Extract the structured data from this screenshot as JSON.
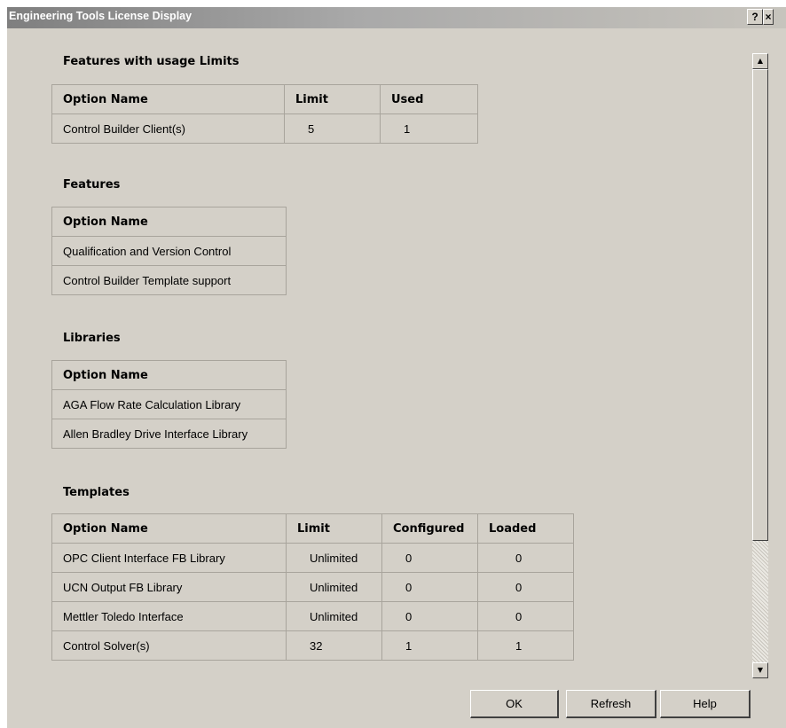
{
  "window": {
    "title": "Engineering Tools License Display",
    "help_glyph": "?",
    "close_glyph": "×"
  },
  "usage_limits": {
    "title": "Features with usage Limits",
    "headers": [
      "Option Name",
      "Limit",
      "Used"
    ],
    "rows": [
      [
        "Control Builder Client(s)",
        "5",
        "1"
      ]
    ]
  },
  "features": {
    "title": "Features",
    "headers": [
      "Option Name"
    ],
    "rows": [
      [
        "Qualification and Version Control"
      ],
      [
        "Control Builder Template support"
      ]
    ]
  },
  "libraries": {
    "title": "Libraries",
    "headers": [
      "Option Name"
    ],
    "rows": [
      [
        "AGA Flow Rate Calculation Library"
      ],
      [
        "Allen Bradley Drive Interface Library"
      ]
    ]
  },
  "templates": {
    "title": "Templates",
    "headers": [
      "Option Name",
      "Limit",
      "Configured",
      "Loaded"
    ],
    "rows": [
      [
        "OPC Client Interface FB Library",
        "Unlimited",
        "0",
        "0"
      ],
      [
        "UCN Output FB Library",
        "Unlimited",
        "0",
        "0"
      ],
      [
        "Mettler Toledo Interface",
        "Unlimited",
        "0",
        "0"
      ],
      [
        "Control Solver(s)",
        "32",
        "1",
        "1"
      ]
    ]
  },
  "scrollbar": {
    "up_icon": "▲",
    "down_icon": "▼",
    "thumb_position": 0.0
  },
  "buttons": {
    "ok": "OK",
    "refresh": "Refresh",
    "help": "Help"
  }
}
